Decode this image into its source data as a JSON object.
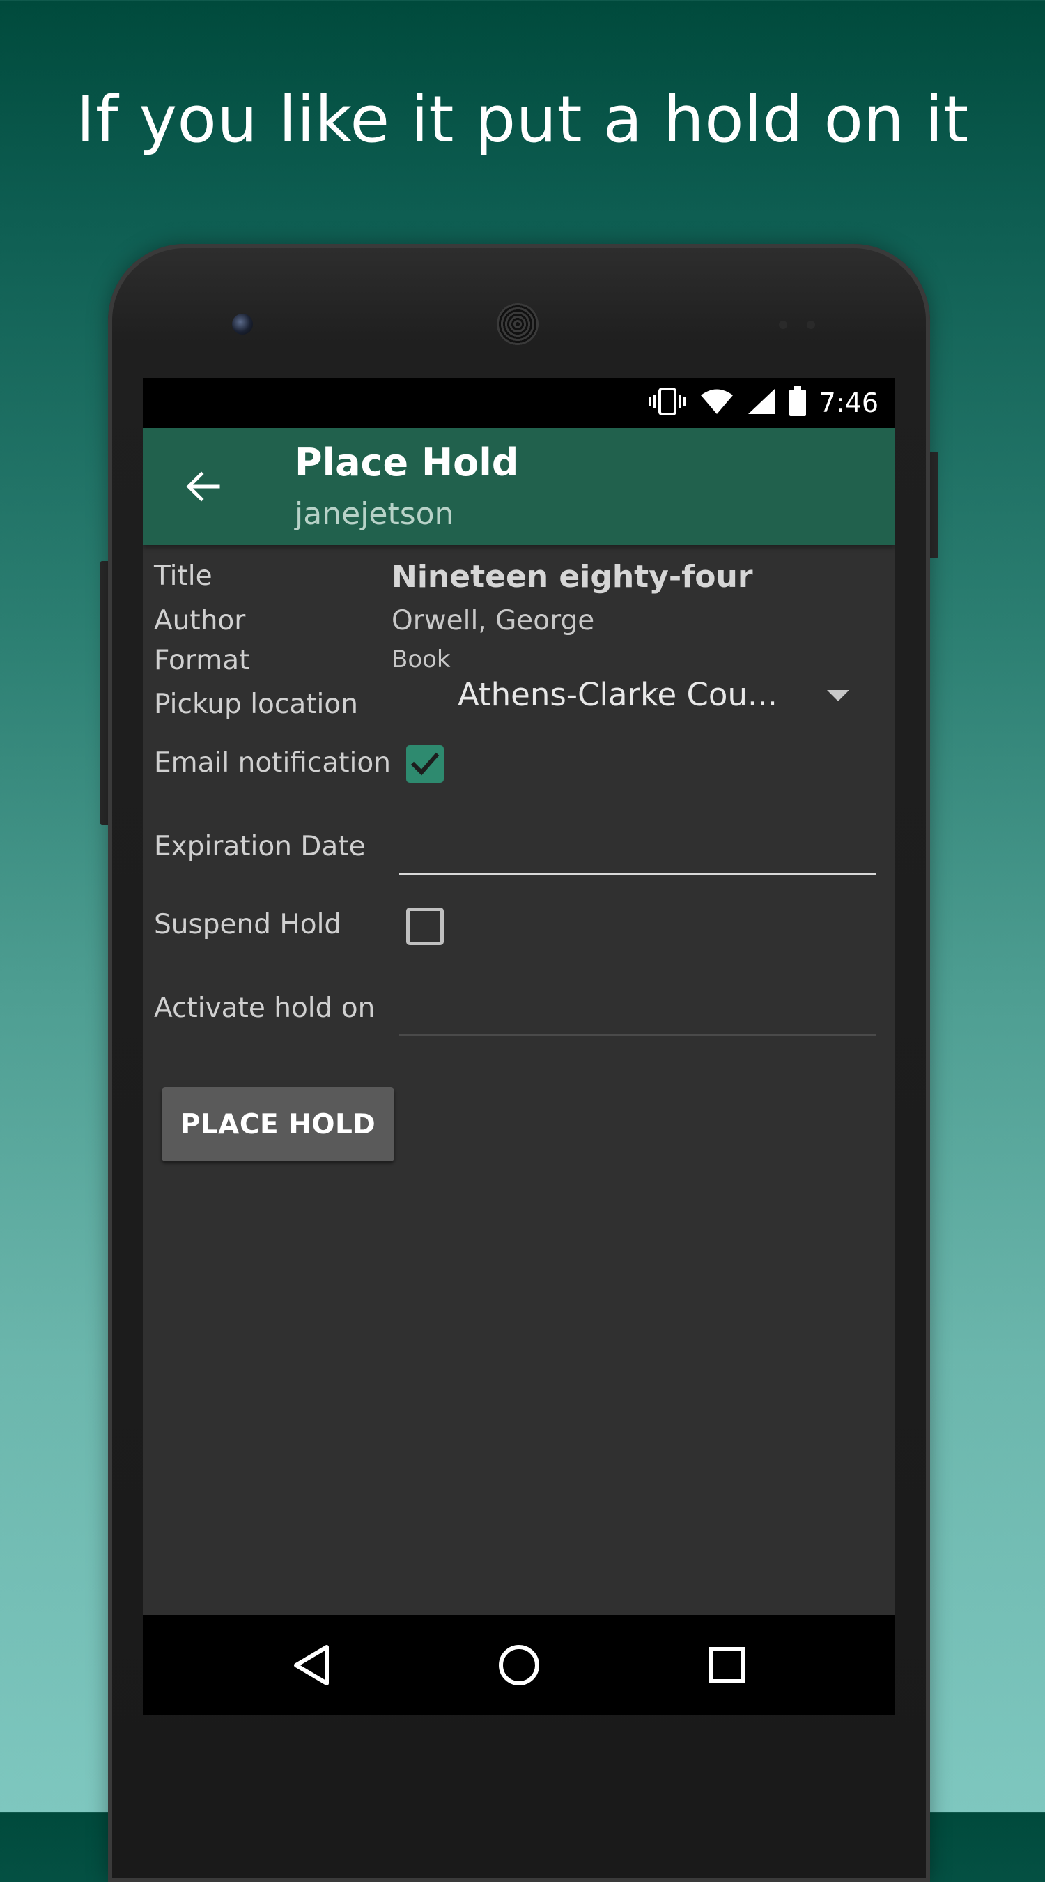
{
  "promo": {
    "headline": "If you like it put a hold on it"
  },
  "status_bar": {
    "time": "7:46",
    "icons": [
      "vibrate-icon",
      "wifi-icon",
      "signal-icon",
      "battery-icon"
    ]
  },
  "app_bar": {
    "title": "Place Hold",
    "subtitle": "janejetson",
    "back_icon": "arrow-back-icon",
    "color": "#21614d"
  },
  "form": {
    "title_label": "Title",
    "title_value": "Nineteen eighty-four",
    "author_label": "Author",
    "author_value": "Orwell, George",
    "format_label": "Format",
    "format_value": "Book",
    "pickup_label": "Pickup location",
    "pickup_value": "Athens-Clarke Cou...",
    "email_label": "Email notification",
    "email_checked": true,
    "expiration_label": "Expiration Date",
    "expiration_value": "",
    "suspend_label": "Suspend Hold",
    "suspend_checked": false,
    "activate_label": "Activate hold on",
    "activate_value": "",
    "submit_label": "PLACE HOLD"
  },
  "nav_bar": {
    "icons": [
      "back-triangle-icon",
      "home-circle-icon",
      "recents-square-icon"
    ]
  },
  "colors": {
    "accent": "#2e8a6f",
    "screen_background": "#303030",
    "button": "#5a5a5a"
  }
}
